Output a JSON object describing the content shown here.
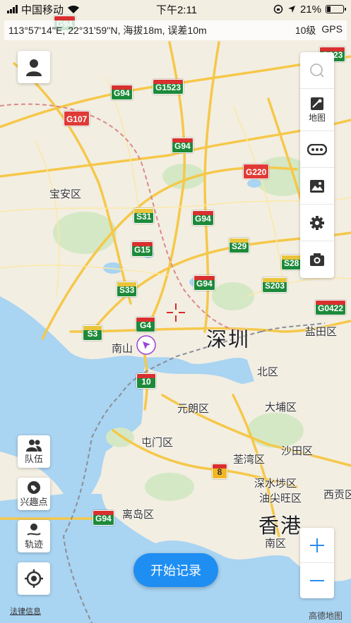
{
  "status_bar": {
    "carrier": "中国移动",
    "time": "下午2:11",
    "battery": "21%"
  },
  "coords": {
    "text": "113°57'14''E,  22°31'59''N, 海拔18m, 误差10m",
    "zoom": "10级",
    "gps": "GPS"
  },
  "tools": [
    {
      "name": "search",
      "label": ""
    },
    {
      "name": "map-layers",
      "label": "地图"
    },
    {
      "name": "more",
      "label": ""
    },
    {
      "name": "image",
      "label": ""
    },
    {
      "name": "settings",
      "label": ""
    },
    {
      "name": "camera",
      "label": ""
    }
  ],
  "left_buttons": {
    "team": "队伍",
    "poi": "兴趣点",
    "track": "轨迹"
  },
  "start_button": "开始记录",
  "legal": "法律信息",
  "brand": "高德地图",
  "map_labels": {
    "baoan": "宝安区",
    "nanshan": "南山",
    "shenzhen": "深圳",
    "yantian": "盐田区",
    "north": "北区",
    "yuenlong": "元朗区",
    "taipo": "大埔区",
    "tuenmun": "屯门区",
    "shatin": "沙田区",
    "tsuenwan": "荃湾区",
    "shamshuipo": "深水埗区",
    "yautsim": "油尖旺区",
    "islands": "离岛区",
    "hongkong": "香港",
    "southern": "南区",
    "wanchai": "西贡区"
  },
  "shields": {
    "g94a": "G94",
    "g94b": "G94",
    "g94c": "G94",
    "g94d": "G94",
    "g94e": "G94",
    "g94f": "G94",
    "g94g": "G94",
    "g1523": "G1523",
    "g107": "G107",
    "g220": "G220",
    "s31": "S31",
    "g15": "G15",
    "s29": "S29",
    "s28": "S28",
    "s203": "S203",
    "s33": "S33",
    "g4": "G4",
    "s3": "S3",
    "g10": "10",
    "g0422": "G0422",
    "g123": "G123",
    "s8": "8"
  }
}
